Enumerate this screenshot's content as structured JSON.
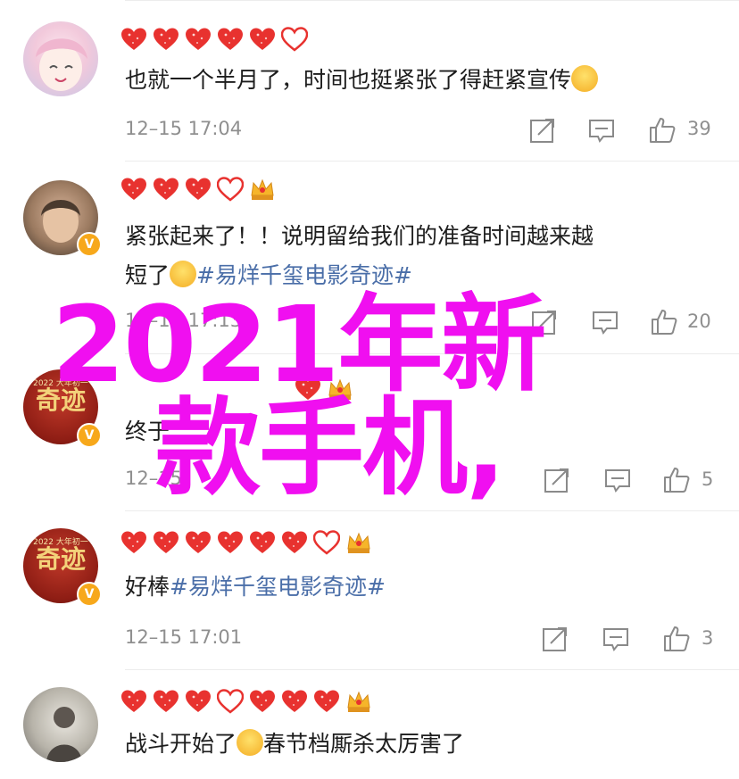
{
  "comments": [
    {
      "text": "也就一个半月了，时间也挺紧张了得赶紧宣传",
      "time": "12–15 17:04",
      "likes": "39"
    },
    {
      "text_line1": "紧张起来了！！说明留给我们的准备时间越来越",
      "text_line2_plain": "短了",
      "topic": "#易烊千玺电影奇迹#",
      "time": "12–15 17:13",
      "likes": "20"
    },
    {
      "text_plain": "终于",
      "time": "12–15",
      "likes": "5"
    },
    {
      "text_plain": "好棒",
      "topic": "#易烊千玺电影奇迹#",
      "time": "12–15 17:01",
      "likes": "3"
    },
    {
      "text_before": "战斗开始了",
      "text_after": "春节档厮杀太厉害了"
    }
  ],
  "avatars": {
    "poster_sub": "2022 大年初一",
    "poster_main": "奇迹",
    "verified_mark": "V"
  },
  "overlay": {
    "line1": "2021年新",
    "line2": "款手机,"
  },
  "colors": {
    "overlay": "#f00ff0",
    "topic": "#4a6ea8",
    "heart": "#e8322f",
    "verified": "#f7a81b"
  },
  "icons": [
    "share-icon",
    "comment-icon",
    "like-icon",
    "heart-badge-icon",
    "crown-badge-icon"
  ]
}
